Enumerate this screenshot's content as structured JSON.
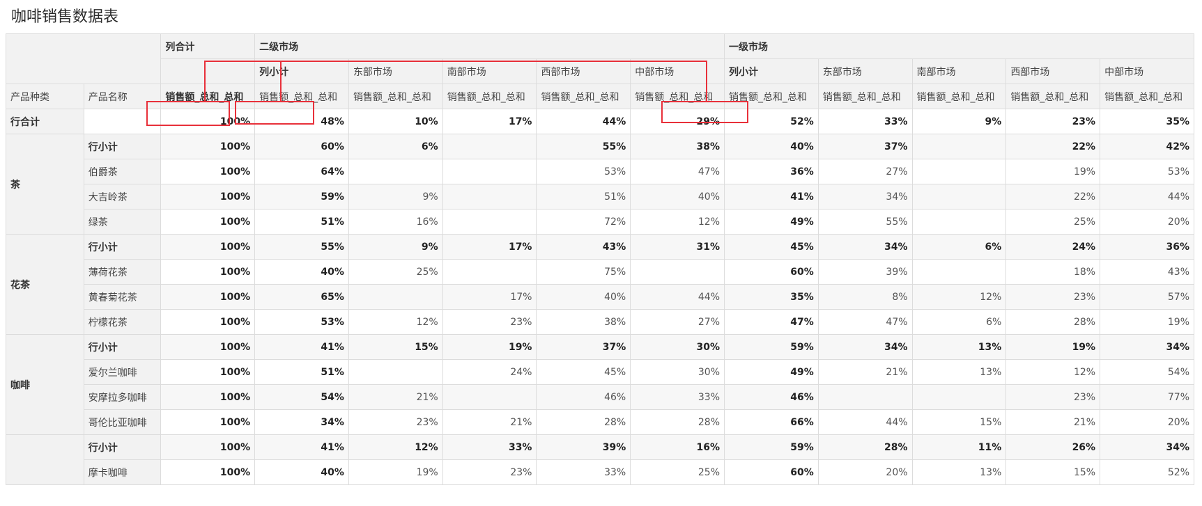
{
  "title": "咖啡销售数据表",
  "header": {
    "top_left": "",
    "col_total": "列合计",
    "group1": "二级市场",
    "group2": "一级市场",
    "sub_cols": [
      "列小计",
      "东部市场",
      "南部市场",
      "西部市场",
      "中部市场"
    ],
    "row_dim1": "产品种类",
    "row_dim2": "产品名称",
    "measure_bold": "销售额_总和_总和",
    "measure": "销售额_总和_总和"
  },
  "grand_total": {
    "label": "行合计",
    "values": [
      "100%",
      "48%",
      "10%",
      "17%",
      "44%",
      "29%",
      "52%",
      "33%",
      "9%",
      "23%",
      "35%"
    ]
  },
  "groups": [
    {
      "category": "茶",
      "rows": [
        {
          "name": "行小计",
          "subtotal": true,
          "values": [
            "100%",
            "60%",
            "6%",
            "",
            "55%",
            "38%",
            "40%",
            "37%",
            "",
            "22%",
            "42%"
          ]
        },
        {
          "name": "伯爵茶",
          "subtotal": false,
          "values": [
            "100%",
            "64%",
            "",
            "",
            "53%",
            "47%",
            "36%",
            "27%",
            "",
            "19%",
            "53%"
          ]
        },
        {
          "name": "大吉岭茶",
          "subtotal": false,
          "values": [
            "100%",
            "59%",
            "9%",
            "",
            "51%",
            "40%",
            "41%",
            "34%",
            "",
            "22%",
            "44%"
          ]
        },
        {
          "name": "绿茶",
          "subtotal": false,
          "values": [
            "100%",
            "51%",
            "16%",
            "",
            "72%",
            "12%",
            "49%",
            "55%",
            "",
            "25%",
            "20%"
          ]
        }
      ]
    },
    {
      "category": "花茶",
      "rows": [
        {
          "name": "行小计",
          "subtotal": true,
          "values": [
            "100%",
            "55%",
            "9%",
            "17%",
            "43%",
            "31%",
            "45%",
            "34%",
            "6%",
            "24%",
            "36%"
          ]
        },
        {
          "name": "薄荷花茶",
          "subtotal": false,
          "values": [
            "100%",
            "40%",
            "25%",
            "",
            "75%",
            "",
            "60%",
            "39%",
            "",
            "18%",
            "43%"
          ]
        },
        {
          "name": "黄春菊花茶",
          "subtotal": false,
          "values": [
            "100%",
            "65%",
            "",
            "17%",
            "40%",
            "44%",
            "35%",
            "8%",
            "12%",
            "23%",
            "57%"
          ]
        },
        {
          "name": "柠檬花茶",
          "subtotal": false,
          "values": [
            "100%",
            "53%",
            "12%",
            "23%",
            "38%",
            "27%",
            "47%",
            "47%",
            "6%",
            "28%",
            "19%"
          ]
        }
      ]
    },
    {
      "category": "咖啡",
      "rows": [
        {
          "name": "行小计",
          "subtotal": true,
          "values": [
            "100%",
            "41%",
            "15%",
            "19%",
            "37%",
            "30%",
            "59%",
            "34%",
            "13%",
            "19%",
            "34%"
          ]
        },
        {
          "name": "爱尔兰咖啡",
          "subtotal": false,
          "values": [
            "100%",
            "51%",
            "",
            "24%",
            "45%",
            "30%",
            "49%",
            "21%",
            "13%",
            "12%",
            "54%"
          ]
        },
        {
          "name": "安摩拉多咖啡",
          "subtotal": false,
          "values": [
            "100%",
            "54%",
            "21%",
            "",
            "46%",
            "33%",
            "46%",
            "",
            "",
            "23%",
            "77%"
          ]
        },
        {
          "name": "哥伦比亚咖啡",
          "subtotal": false,
          "values": [
            "100%",
            "34%",
            "23%",
            "21%",
            "28%",
            "28%",
            "66%",
            "44%",
            "15%",
            "21%",
            "20%"
          ]
        }
      ]
    },
    {
      "category": "",
      "rows": [
        {
          "name": "行小计",
          "subtotal": true,
          "values": [
            "100%",
            "41%",
            "12%",
            "33%",
            "39%",
            "16%",
            "59%",
            "28%",
            "11%",
            "26%",
            "34%"
          ]
        },
        {
          "name": "摩卡咖啡",
          "subtotal": false,
          "values": [
            "100%",
            "40%",
            "19%",
            "23%",
            "33%",
            "25%",
            "60%",
            "20%",
            "13%",
            "15%",
            "52%"
          ]
        }
      ]
    }
  ],
  "bold_columns": [
    0,
    1,
    6
  ],
  "accent_color": "#e8303a"
}
